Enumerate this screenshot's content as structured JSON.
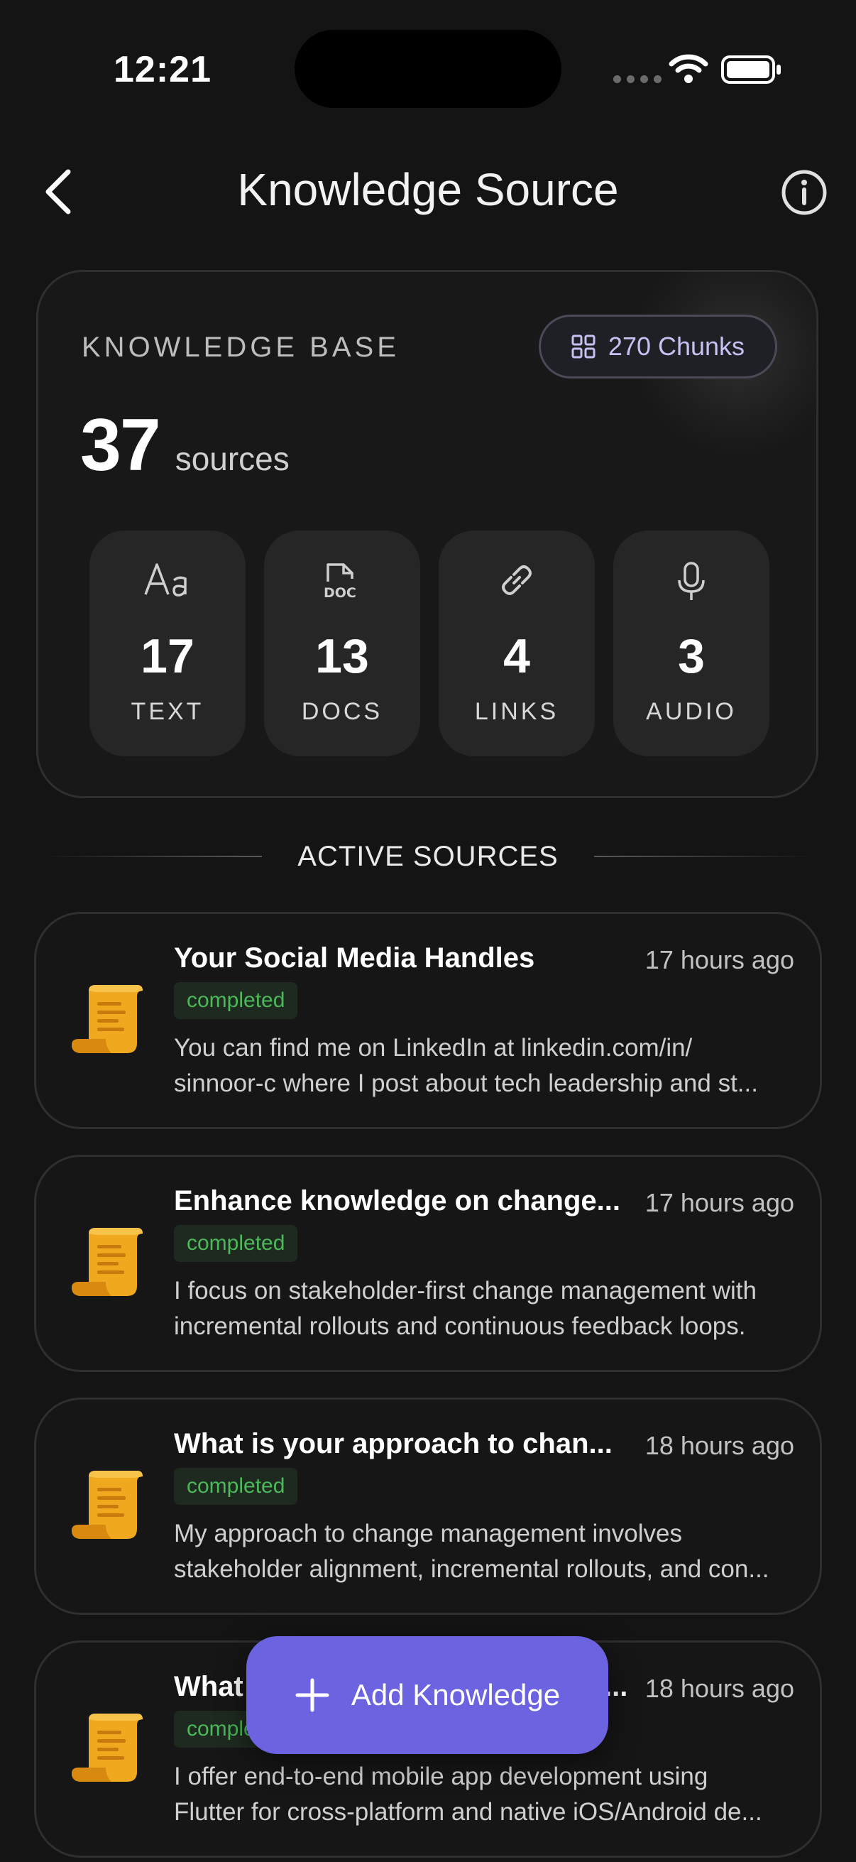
{
  "status_bar": {
    "time": "12:21"
  },
  "header": {
    "title": "Knowledge Source"
  },
  "knowledge_base": {
    "label": "KNOWLEDGE BASE",
    "chunks": "270 Chunks",
    "count": "37",
    "unit": "sources",
    "stats": [
      {
        "icon": "text-format-icon",
        "value": "17",
        "label": "TEXT"
      },
      {
        "icon": "doc-file-icon",
        "value": "13",
        "label": "DOCS"
      },
      {
        "icon": "link-icon",
        "value": "4",
        "label": "LINKS"
      },
      {
        "icon": "microphone-icon",
        "value": "3",
        "label": "AUDIO"
      }
    ]
  },
  "active_sources": {
    "heading": "ACTIVE SOURCES",
    "items": [
      {
        "title": "Your Social Media Handles",
        "time": "17 hours ago",
        "status": "completed",
        "line1": "You can find me on LinkedIn at linkedin.com/in/",
        "line2": "sinnoor-c where I post about tech leadership and st..."
      },
      {
        "title": "Enhance knowledge on change...",
        "time": "17 hours ago",
        "status": "completed",
        "line1": "I focus on stakeholder-first change management with",
        "line2": "incremental rollouts and continuous feedback loops."
      },
      {
        "title": "What is your approach to chan...",
        "time": "18 hours ago",
        "status": "completed",
        "line1": "My approach to change management involves",
        "line2": "stakeholder alignment, incremental rollouts, and con..."
      },
      {
        "title": "What",
        "title_tail": "...",
        "time": "18 hours ago",
        "status": "comple",
        "line1": "I offer end-to-end mobile app development using",
        "line2": "Flutter for cross-platform and native iOS/Android de..."
      }
    ]
  },
  "fab": {
    "label": "Add Knowledge"
  },
  "colors": {
    "accent": "#6c63e0",
    "status_completed": "#4cb85a",
    "background": "#141414"
  }
}
